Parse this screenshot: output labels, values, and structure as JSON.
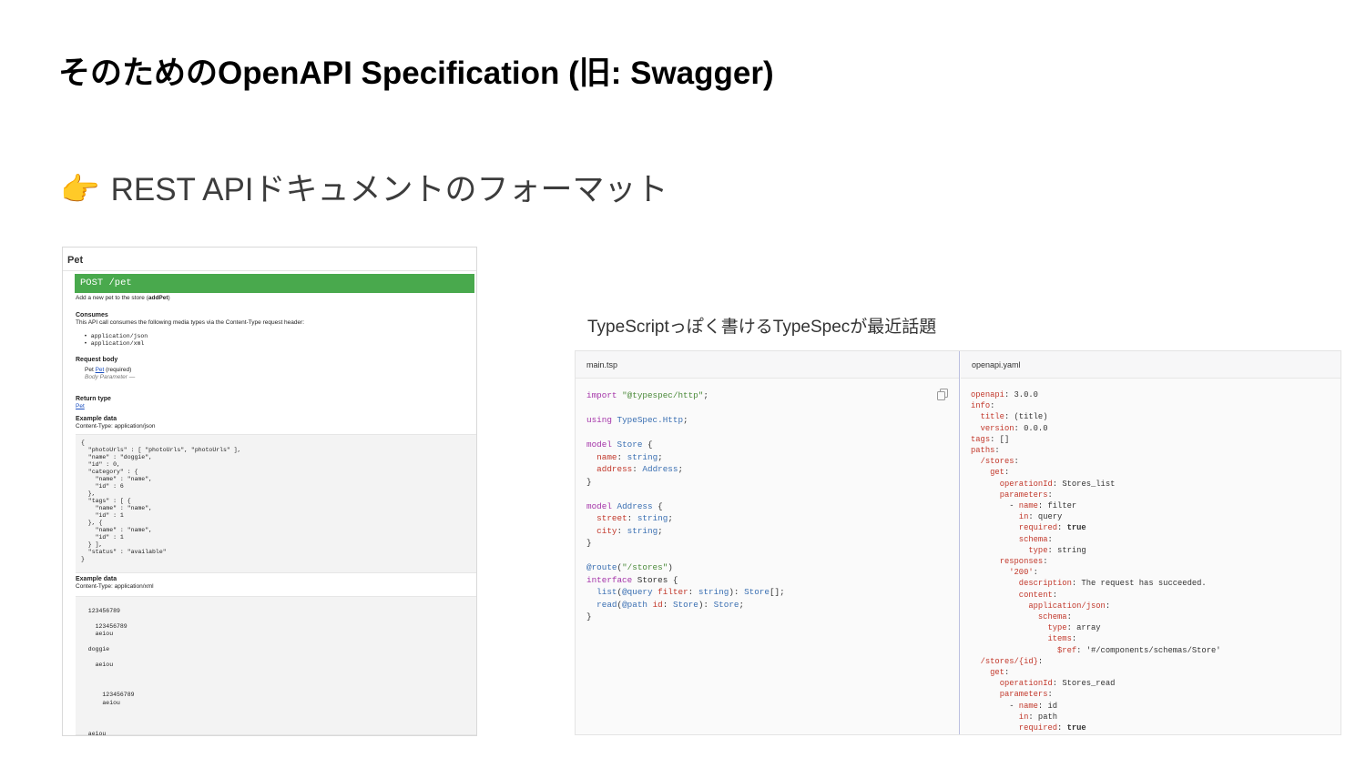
{
  "slide": {
    "title": "そのためのOpenAPI Specification (旧: Swagger)",
    "pointer_icon": "👉",
    "subtitle": "REST APIドキュメントのフォーマット"
  },
  "swagger": {
    "section": "Pet",
    "endpoint": "POST /pet",
    "summary_prefix": "Add a new pet to the store (",
    "summary_op": "addPet",
    "summary_suffix": ")",
    "consumes_heading": "Consumes",
    "consumes_text": "This API call consumes the following media types via the Content-Type request header:",
    "consumes_types": [
      "application/json",
      "application/xml"
    ],
    "request_body_heading": "Request body",
    "request_body_prefix": "Pet ",
    "request_body_link": "Pet",
    "request_body_suffix": " (required)",
    "body_parameter": "Body Parameter —",
    "return_type_heading": "Return type",
    "return_type_link": "Pet",
    "example_heading": "Example data",
    "example_content_type_json": "Content-Type: application/json",
    "json_example": [
      "{",
      "  \"photoUrls\" : [ \"photoUrls\", \"photoUrls\" ],",
      "  \"name\" : \"doggie\",",
      "  \"id\" : 0,",
      "  \"category\" : {",
      "    \"name\" : \"name\",",
      "    \"id\" : 6",
      "  },",
      "  \"tags\" : [ {",
      "    \"name\" : \"name\",",
      "    \"id\" : 1",
      "  }, {",
      "    \"name\" : \"name\",",
      "    \"id\" : 1",
      "  } ],",
      "  \"status\" : \"available\"",
      "}"
    ],
    "example_content_type_xml": "Content-Type: application/xml",
    "xml_example": [
      "  123456789",
      "",
      "    123456789",
      "    aeiou",
      "",
      "  doggie",
      "",
      "    aeiou",
      "",
      "",
      "",
      "      123456789",
      "      aeiou",
      "",
      "",
      "",
      "  aeiou"
    ]
  },
  "typespec": {
    "caption": "TypeScriptっぽく書けるTypeSpecが最近話題",
    "left_tab": "main.tsp",
    "right_tab": "openapi.yaml",
    "copy_icon": "copy-icon",
    "tsp_code": [
      "import \"@typespec/http\";",
      "",
      "using TypeSpec.Http;",
      "",
      "model Store {",
      "  name: string;",
      "  address: Address;",
      "}",
      "",
      "model Address {",
      "  street: string;",
      "  city: string;",
      "}",
      "",
      "@route(\"/stores\")",
      "interface Stores {",
      "  list(@query filter: string): Store[];",
      "  read(@path id: Store): Store;",
      "}"
    ],
    "yaml_code": [
      "openapi: 3.0.0",
      "info:",
      "  title: (title)",
      "  version: 0.0.0",
      "tags: []",
      "paths:",
      "  /stores:",
      "    get:",
      "      operationId: Stores_list",
      "      parameters:",
      "        - name: filter",
      "          in: query",
      "          required: true",
      "          schema:",
      "            type: string",
      "      responses:",
      "        '200':",
      "          description: The request has succeeded.",
      "          content:",
      "            application/json:",
      "              schema:",
      "                type: array",
      "                items:",
      "                  $ref: '#/components/schemas/Store'",
      "  /stores/{id}:",
      "    get:",
      "      operationId: Stores_read",
      "      parameters:",
      "        - name: id",
      "          in: path",
      "          required: true"
    ],
    "colors": {
      "keyword": "#a433a8",
      "string": "#4b8a3a",
      "property": "#c2382b",
      "type": "#3a6fb2"
    }
  }
}
